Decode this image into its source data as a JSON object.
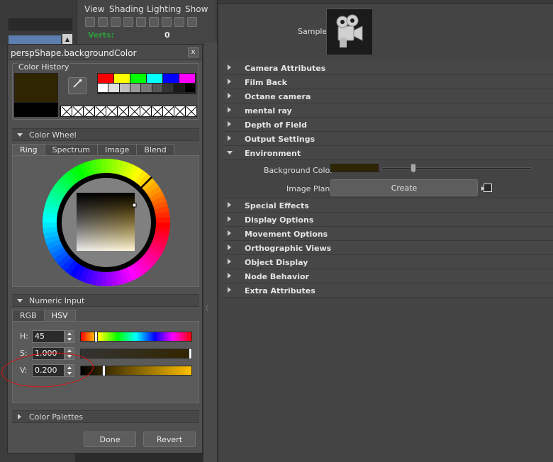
{
  "viewport": {
    "menus": [
      "View",
      "Shading",
      "Lighting",
      "Show"
    ],
    "verts_label": "Verts:",
    "verts_value": "0"
  },
  "attribute_editor": {
    "sample_label": "Sample",
    "sections": [
      {
        "label": "Camera Attributes",
        "expanded": false
      },
      {
        "label": "Film Back",
        "expanded": false
      },
      {
        "label": "Octane camera",
        "expanded": false
      },
      {
        "label": "mental ray",
        "expanded": false
      },
      {
        "label": "Depth of Field",
        "expanded": false
      },
      {
        "label": "Output Settings",
        "expanded": false
      },
      {
        "label": "Environment",
        "expanded": true
      },
      {
        "label": "Special Effects",
        "expanded": false
      },
      {
        "label": "Display Options",
        "expanded": false
      },
      {
        "label": "Movement Options",
        "expanded": false
      },
      {
        "label": "Orthographic Views",
        "expanded": false
      },
      {
        "label": "Object Display",
        "expanded": false
      },
      {
        "label": "Node Behavior",
        "expanded": false
      },
      {
        "label": "Extra Attributes",
        "expanded": false
      }
    ],
    "environment": {
      "background_color_label": "Background Color",
      "background_color": "#2f2500",
      "image_plane_label": "Image Plane",
      "create_label": "Create"
    }
  },
  "color_dialog": {
    "title": "perspShape.backgroundColor",
    "close_label": "x",
    "color_history_label": "Color History",
    "current_color": "#2f2500",
    "palette_row1": [
      "#ff0000",
      "#ffff00",
      "#00ff00",
      "#00ffff",
      "#0000ff",
      "#ff00ff"
    ],
    "palette_row2": [
      "#ffffff",
      "#e0e0e0",
      "#bdbdbd",
      "#999999",
      "#777777",
      "#555555",
      "#333333",
      "#1a1a1a",
      "#000000"
    ],
    "color_wheel_label": "Color Wheel",
    "wheel_tabs": [
      "Ring",
      "Spectrum",
      "Image",
      "Blend"
    ],
    "numeric_input_label": "Numeric Input",
    "numeric_tabs": [
      "RGB",
      "HSV"
    ],
    "hsv": {
      "h_label": "H:",
      "h_value": "45",
      "h_fraction": 0.125,
      "s_label": "S:",
      "s_value": "1.000",
      "s_fraction": 1.0,
      "v_label": "V:",
      "v_value": "0.200",
      "v_fraction": 0.2
    },
    "color_palettes_label": "Color Palettes",
    "done_label": "Done",
    "revert_label": "Revert"
  }
}
